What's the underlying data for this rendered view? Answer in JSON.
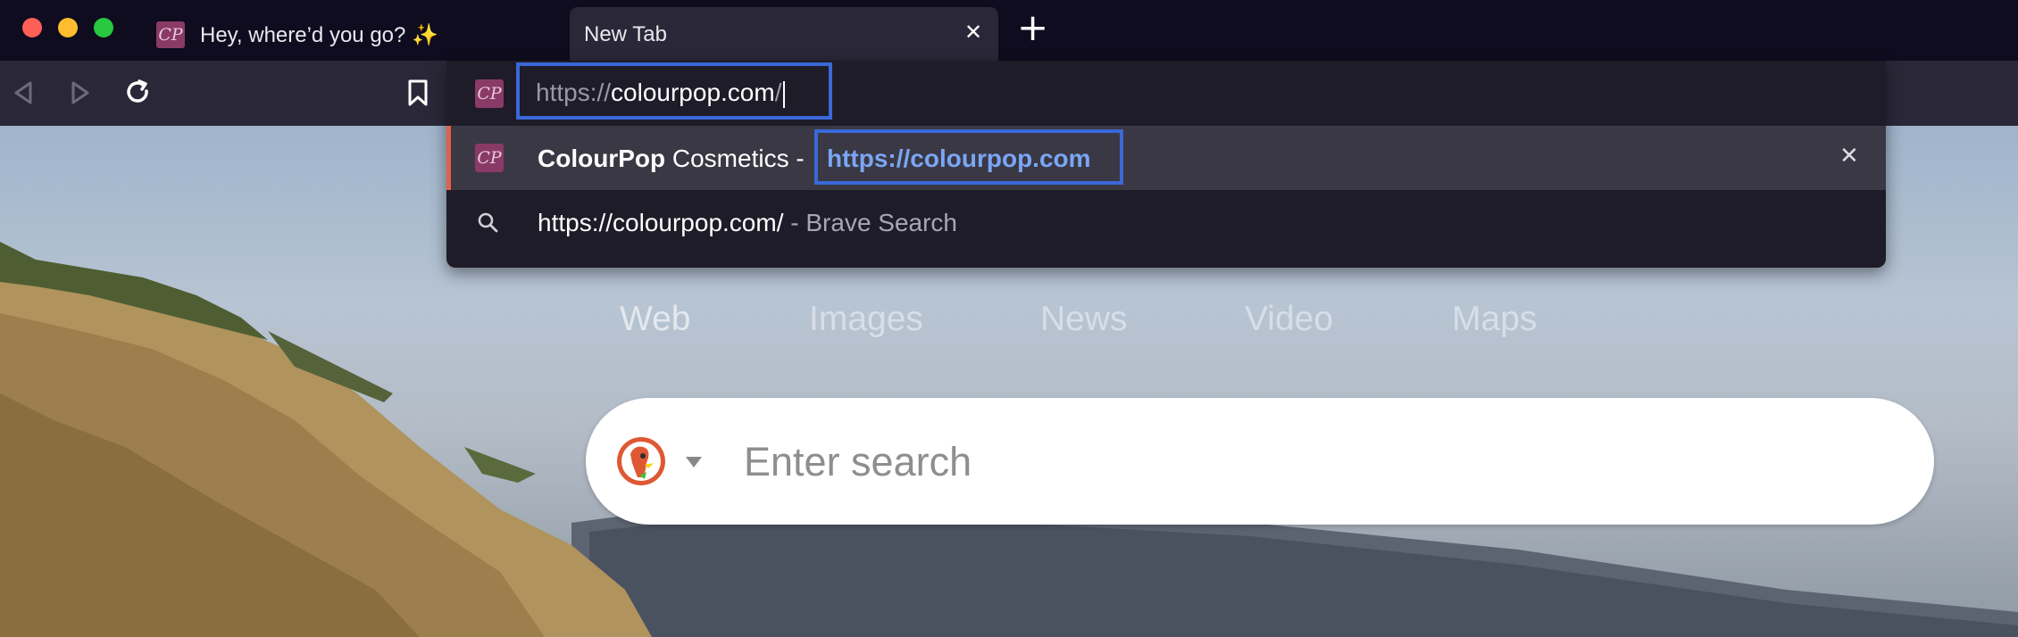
{
  "tabs": [
    {
      "title": "Hey, where’d you go? ✨",
      "favicon": "CP",
      "active": false
    },
    {
      "title": "New Tab",
      "active": true
    }
  ],
  "new_tab_symbol": "+",
  "close_symbol": "✕",
  "address_bar": {
    "scheme": "https://",
    "host": "colourpop.com",
    "trailing": "/"
  },
  "suggestions": [
    {
      "favicon": "CP",
      "bold": "ColourPop",
      "text": " Cosmetics - ",
      "url": "https://colourpop.com",
      "selected": true
    },
    {
      "icon": "search-icon",
      "query": "https://colourpop.com/",
      "suffix": " - Brave Search"
    }
  ],
  "search_page": {
    "tabs": [
      "Web",
      "Images",
      "News",
      "Video",
      "Maps"
    ],
    "placeholder": "Enter search"
  },
  "colors": {
    "accent_highlight": "#3a68d8",
    "url_blue": "#7aa6f5",
    "selected_row_marker": "#e0624a"
  }
}
